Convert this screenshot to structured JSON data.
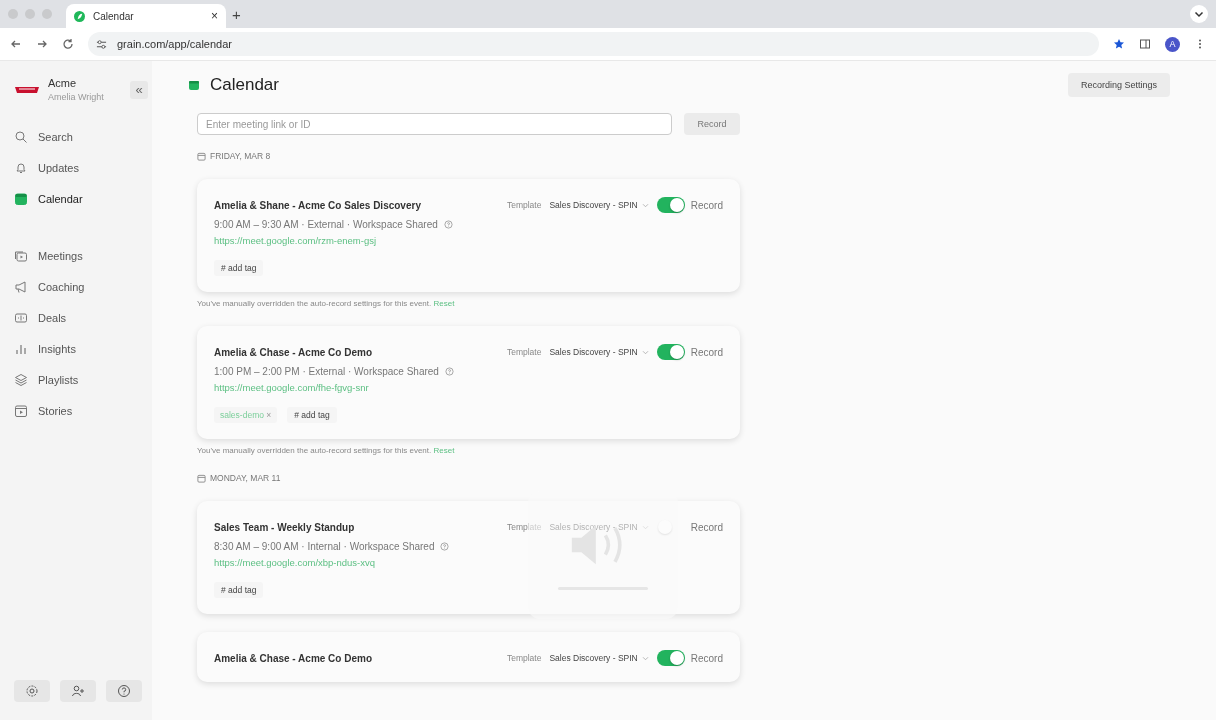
{
  "browser": {
    "tab_title": "Calendar",
    "tab_close": "×",
    "new_tab": "+",
    "url": "grain.com/app/calendar",
    "avatar": "A"
  },
  "sidebar": {
    "org": "Acme",
    "user": "Amelia Wright",
    "collapse": "«",
    "items_top": [
      {
        "label": "Search",
        "selected": false
      },
      {
        "label": "Updates",
        "selected": false
      },
      {
        "label": "Calendar",
        "selected": true
      }
    ],
    "items_bottom": [
      {
        "label": "Meetings",
        "selected": false
      },
      {
        "label": "Coaching",
        "selected": false
      },
      {
        "label": "Deals",
        "selected": false
      },
      {
        "label": "Insights",
        "selected": false
      },
      {
        "label": "Playlists",
        "selected": false
      },
      {
        "label": "Stories",
        "selected": false
      }
    ]
  },
  "page": {
    "title": "Calendar",
    "settings_button": "Recording Settings",
    "meeting_field": {
      "placeholder": "Enter meeting link or ID"
    },
    "record_button": "Record"
  },
  "days": [
    {
      "label": "FRIDAY, MAR 8",
      "events": [
        {
          "title": "Amelia & Shane - Acme Co Sales Discovery",
          "meta": "9:00 AM – 9:30 AM · External · Workspace Shared",
          "link": "https://meet.google.com/rzm-enem-gsj",
          "template_label": "Template",
          "template": "Sales Discovery - SPIN",
          "record_on": true,
          "record_label": "Record",
          "add_tag": "# add tag",
          "note": "You've manually overridden the auto-record settings for this event.",
          "reset": "Reset"
        },
        {
          "title": "Amelia & Chase - Acme Co Demo",
          "meta": "1:00 PM – 2:00 PM · External · Workspace Shared",
          "link": "https://meet.google.com/fhe-fgvg-snr",
          "template_label": "Template",
          "template": "Sales Discovery - SPIN",
          "record_on": true,
          "record_label": "Record",
          "tags": [
            {
              "label": "sales-demo",
              "remove": "×"
            }
          ],
          "add_tag": "# add tag",
          "note": "You've manually overridden the auto-record settings for this event.",
          "reset": "Reset"
        }
      ]
    },
    {
      "label": "MONDAY, MAR 11",
      "events": [
        {
          "title": "Sales Team - Weekly Standup",
          "meta": "8:30 AM – 9:00 AM · Internal · Workspace Shared",
          "link": "https://meet.google.com/xbp-ndus-xvq",
          "template_label": "Template",
          "template": "Sales Discovery - SPIN",
          "record_on": false,
          "record_label": "Record",
          "add_tag": "# add tag"
        },
        {
          "title": "Amelia & Chase - Acme Co Demo",
          "template_label": "Template",
          "template": "Sales Discovery - SPIN",
          "record_on": true,
          "record_label": "Record"
        }
      ]
    }
  ]
}
